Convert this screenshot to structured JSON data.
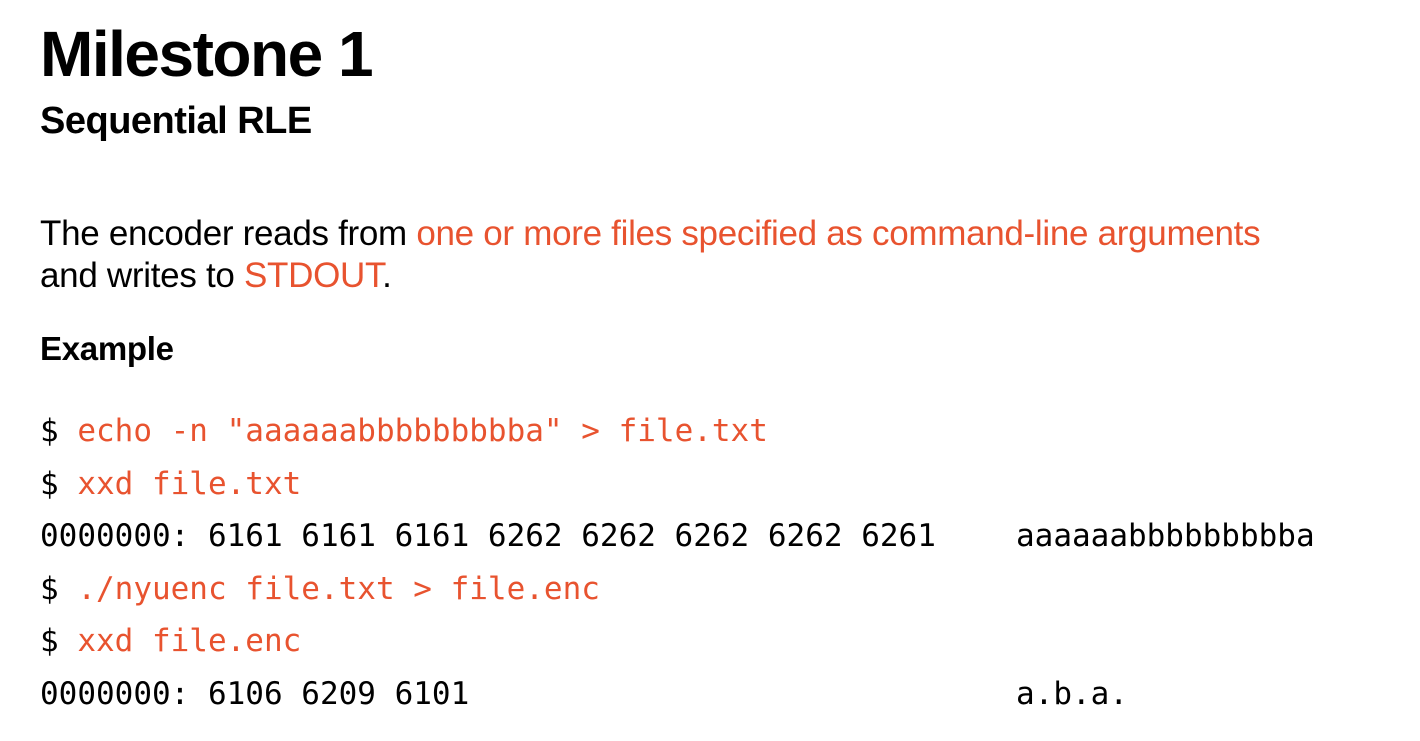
{
  "title": "Milestone 1",
  "subtitle": "Sequential RLE",
  "paragraph": {
    "part1": "The encoder reads from ",
    "highlight1": "one or more files specified as command-line arguments",
    "part2": "and writes to ",
    "highlight2": "STDOUT",
    "part3": "."
  },
  "example_heading": "Example",
  "terminal": {
    "prompt": "$ ",
    "lines": [
      {
        "type": "command",
        "text": "echo -n \"aaaaaabbbbbbbbba\" > file.txt"
      },
      {
        "type": "command",
        "text": "xxd file.txt"
      },
      {
        "type": "output",
        "hex": "0000000: 6161 6161 6161 6262 6262 6262 6262 6261",
        "ascii": "aaaaaabbbbbbbbba"
      },
      {
        "type": "command",
        "text": "./nyuenc file.txt > file.enc"
      },
      {
        "type": "command",
        "text": "xxd file.enc"
      },
      {
        "type": "output",
        "hex": "0000000: 6106 6209 6101",
        "ascii": "a.b.a."
      }
    ]
  },
  "colors": {
    "accent": "#e8532f",
    "text": "#000000",
    "background": "#ffffff"
  }
}
